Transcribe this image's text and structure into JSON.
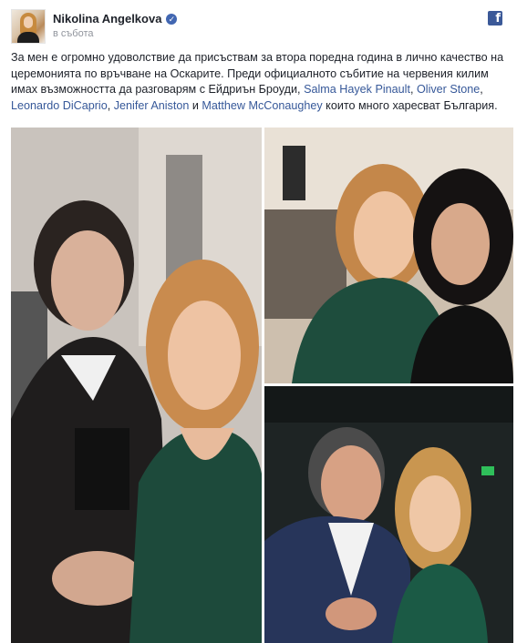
{
  "post": {
    "author": "Nikolina Angelkova",
    "verified_icon": "verified-badge-icon",
    "timestamp": "в събота",
    "network_icon": "facebook-icon",
    "network_glyph": "f",
    "body": {
      "text_before": "За мен е огромно удоволствие да присъствам за втора поредна година в лично качество на церемонията по връчване на Оскарите. Преди официалното събитие на червения килим имах възможността да разговарям с Ейдриън Броуди, ",
      "mentions": [
        "Salma Hayek Pinault",
        "Oliver Stone",
        "Leonardo DiCaprio",
        "Jenifer Aniston",
        "Matthew McConaughey"
      ],
      "sep1": ", ",
      "sep2": ", ",
      "sep3": ", ",
      "sep4": " и ",
      "text_after": " които много харесват България."
    }
  },
  "photos": [
    {
      "alt": "photo-adrien-brody"
    },
    {
      "alt": "photo-salma-hayek"
    },
    {
      "alt": "photo-oliver-stone"
    }
  ]
}
